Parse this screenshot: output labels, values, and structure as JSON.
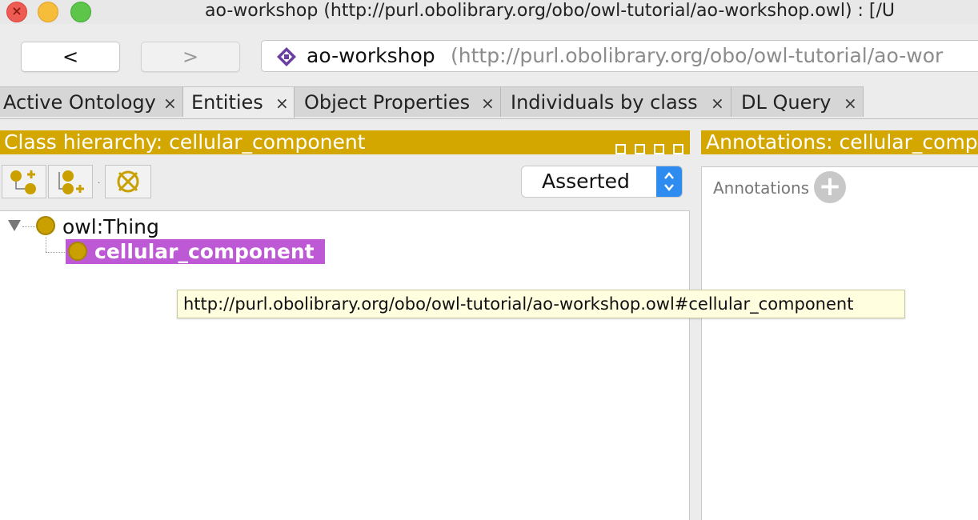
{
  "window": {
    "title": "ao-workshop (http://purl.obolibrary.org/obo/owl-tutorial/ao-workshop.owl)  : [/U"
  },
  "nav": {
    "back_label": "<",
    "forward_label": ">",
    "ontology_name": "ao-workshop",
    "ontology_iri": "(http://purl.obolibrary.org/obo/owl-tutorial/ao-wor"
  },
  "tabs": [
    {
      "label": "Active Ontology",
      "close": "×",
      "active": false
    },
    {
      "label": "Entities",
      "close": "×",
      "active": true
    },
    {
      "label": "Object Properties",
      "close": "×",
      "active": false
    },
    {
      "label": "Individuals by class",
      "close": "×",
      "active": false
    },
    {
      "label": "DL Query",
      "close": "×",
      "active": false
    }
  ],
  "class_hierarchy": {
    "title": "Class hierarchy: cellular_component",
    "mode_selected": "Asserted",
    "tree": {
      "root": "owl:Thing",
      "children": [
        "cellular_component"
      ],
      "selected": "cellular_component"
    }
  },
  "annotations": {
    "title": "Annotations: cellular_comp",
    "label": "Annotations"
  },
  "tooltip": {
    "text": "http://purl.obolibrary.org/obo/owl-tutorial/ao-workshop.owl#cellular_component"
  },
  "colors": {
    "header": "#d4a700",
    "selection": "#bd59d4",
    "class_icon": "#c9a000",
    "tooltip_bg": "#ffffe0",
    "select_accent": "#2e8bf0"
  },
  "icons": {
    "add_subclass": "add-subclass-icon",
    "add_sibling": "add-sibling-class-icon",
    "delete_class": "delete-class-icon",
    "ontology": "ontology-diamond-icon"
  }
}
